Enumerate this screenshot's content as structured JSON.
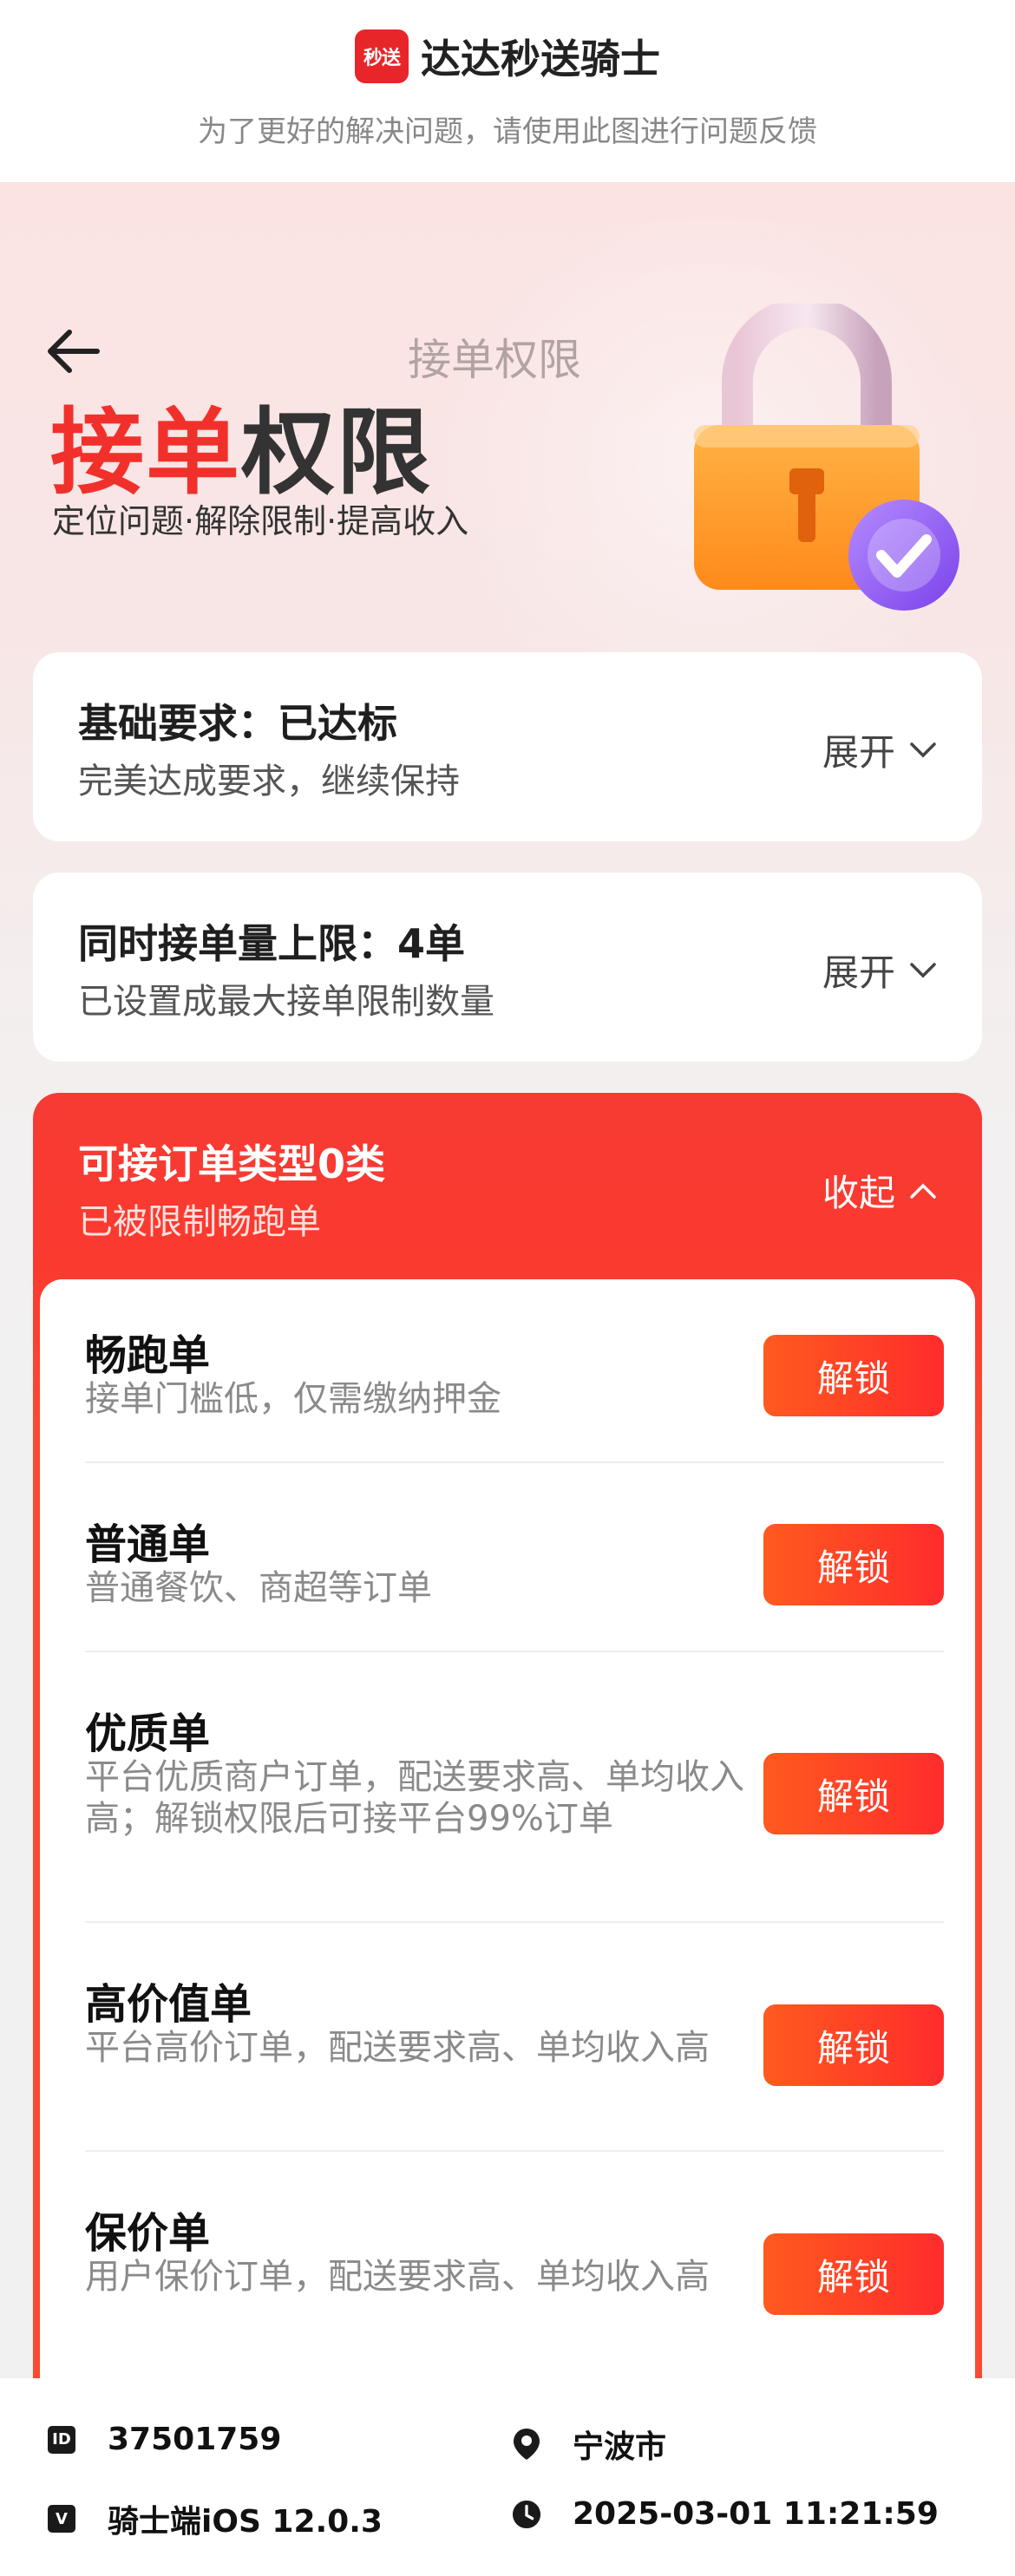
{
  "brand": {
    "logo_text": "秒送",
    "name": "达达秒送骑士",
    "tip": "为了更好的解决问题，请使用此图进行问题反馈"
  },
  "nav": {
    "title": "接单权限"
  },
  "hero": {
    "title_red": "接单",
    "title_dark": "权限",
    "subtitle": "定位问题·解除限制·提高收入"
  },
  "cards": [
    {
      "title": "基础要求：已达标",
      "desc": "完美达成要求，继续保持",
      "toggle": "展开"
    },
    {
      "title": "同时接单量上限：4单",
      "desc": "已设置成最大接单限制数量",
      "toggle": "展开"
    }
  ],
  "order_types": {
    "title": "可接订单类型0类",
    "desc": "已被限制畅跑单",
    "toggle": "收起",
    "items": [
      {
        "name": "畅跑单",
        "desc": "接单门槛低，仅需缴纳押金",
        "button": "解锁"
      },
      {
        "name": "普通单",
        "desc": "普通餐饮、商超等订单",
        "button": "解锁"
      },
      {
        "name": "优质单",
        "desc": "平台优质商户订单，配送要求高、单均收入高；解锁权限后可接平台99%订单",
        "button": "解锁"
      },
      {
        "name": "高价值单",
        "desc": "平台高价订单，配送要求高、单均收入高",
        "button": "解锁"
      },
      {
        "name": "保价单",
        "desc": "用户保价订单，配送要求高、单均收入高",
        "button": "解锁"
      }
    ]
  },
  "footer": {
    "id_badge": "ID",
    "id_value": "37501759",
    "city": "宁波市",
    "version_badge": "V",
    "version": "骑士端iOS  12.0.3",
    "datetime": "2025-03-01 11:21:59"
  }
}
